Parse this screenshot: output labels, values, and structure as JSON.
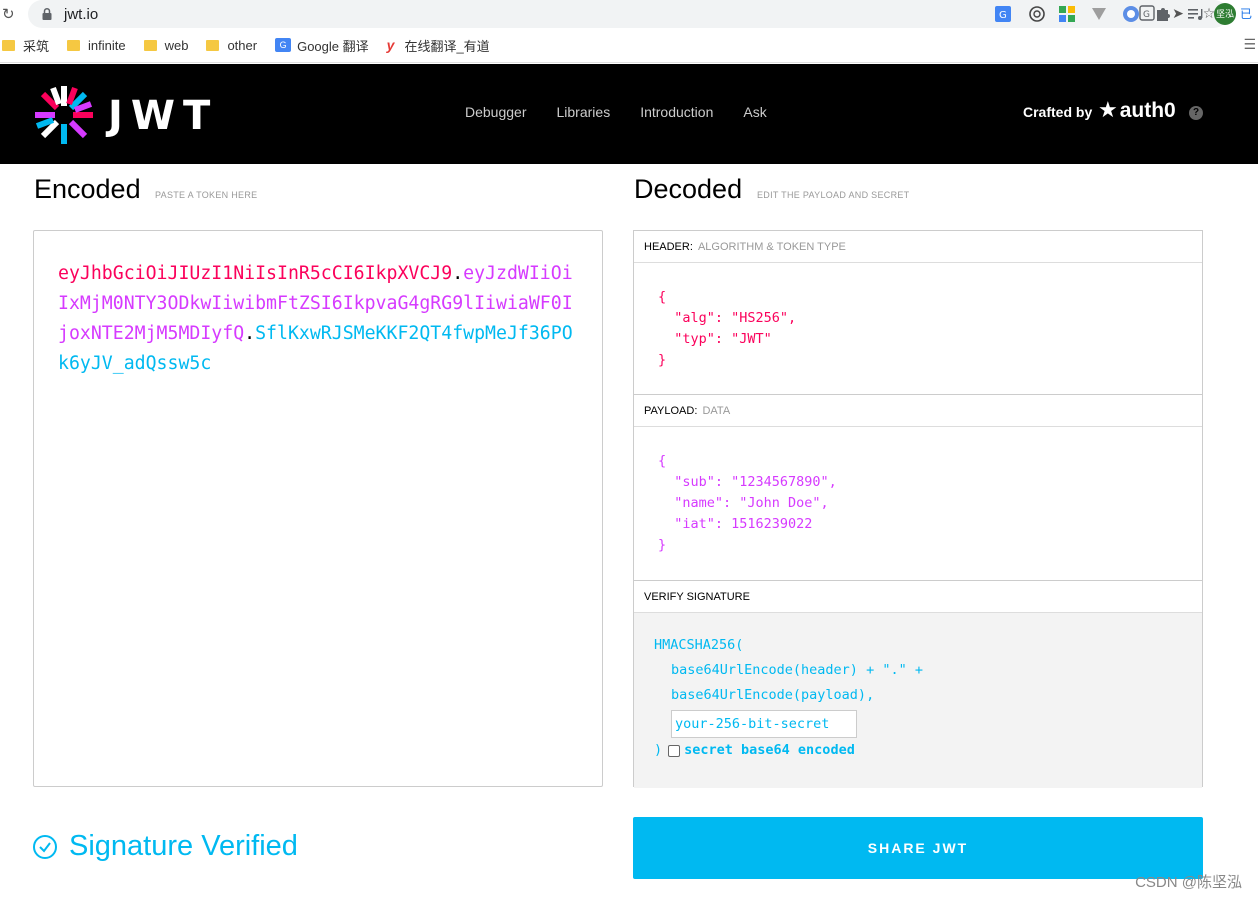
{
  "browser": {
    "url": "jwt.io",
    "extensions": [
      "translate-icon",
      "send-icon",
      "star-icon",
      "google-translate-ext-icon",
      "circle-ext-icon",
      "grid-ext-icon",
      "vee-ext-icon",
      "wallet-ext-icon",
      "puzzle-icon",
      "media-icon"
    ],
    "profile_label": "坚泓",
    "profile_extra": "已",
    "bookmarks": [
      {
        "label": "采筑",
        "icon": "folder-icon"
      },
      {
        "label": "infinite",
        "icon": "folder-icon"
      },
      {
        "label": "web",
        "icon": "folder-icon"
      },
      {
        "label": "other",
        "icon": "folder-icon"
      },
      {
        "label": "Google 翻译",
        "icon": "google-translate-icon"
      },
      {
        "label": "在线翻译_有道",
        "icon": "youdao-icon"
      }
    ]
  },
  "nav": {
    "logo_text": "JWT",
    "links": [
      "Debugger",
      "Libraries",
      "Introduction",
      "Ask"
    ],
    "crafted_by": "Crafted by",
    "brand": "auth0",
    "help": "?"
  },
  "encoded": {
    "title": "Encoded",
    "subtitle": "PASTE A TOKEN HERE",
    "header_part": "eyJhbGciOiJIUzI1NiIsInR5cCI6IkpXVCJ9",
    "payload_part": "eyJzdWIiOiIxMjM0NTY3ODkwIiwibmFtZSI6IkpvaG4gRG9lIiwiaWF0IjoxNTE2MjM5MDIyfQ",
    "signature_part": "SflKxwRJSMeKKF2QT4fwpMeJf36POk6yJV_adQssw5c",
    "dot": "."
  },
  "decoded": {
    "title": "Decoded",
    "subtitle": "EDIT THE PAYLOAD AND SECRET",
    "header": {
      "title": "HEADER:",
      "sub": "ALGORITHM & TOKEN TYPE",
      "lines": [
        "{",
        "  \"alg\": \"HS256\",",
        "  \"typ\": \"JWT\"",
        "}"
      ]
    },
    "payload": {
      "title": "PAYLOAD:",
      "sub": "DATA",
      "lines": [
        "{",
        "  \"sub\": \"1234567890\",",
        "  \"name\": \"John Doe\",",
        "  \"iat\": 1516239022",
        "}"
      ]
    },
    "verify": {
      "title": "VERIFY SIGNATURE",
      "line1": "HMACSHA256(",
      "line2": "base64UrlEncode(header) + \".\" +",
      "line3": "base64UrlEncode(payload),",
      "secret_placeholder": "your-256-bit-secret",
      "close": ")",
      "checkbox_label": "secret base64 encoded"
    }
  },
  "footer": {
    "status": "Signature Verified",
    "share": "SHARE JWT",
    "watermark": "CSDN @陈坚泓"
  },
  "colors": {
    "header": "#fb015b",
    "payload": "#d63aff",
    "signature": "#00b9f1"
  }
}
